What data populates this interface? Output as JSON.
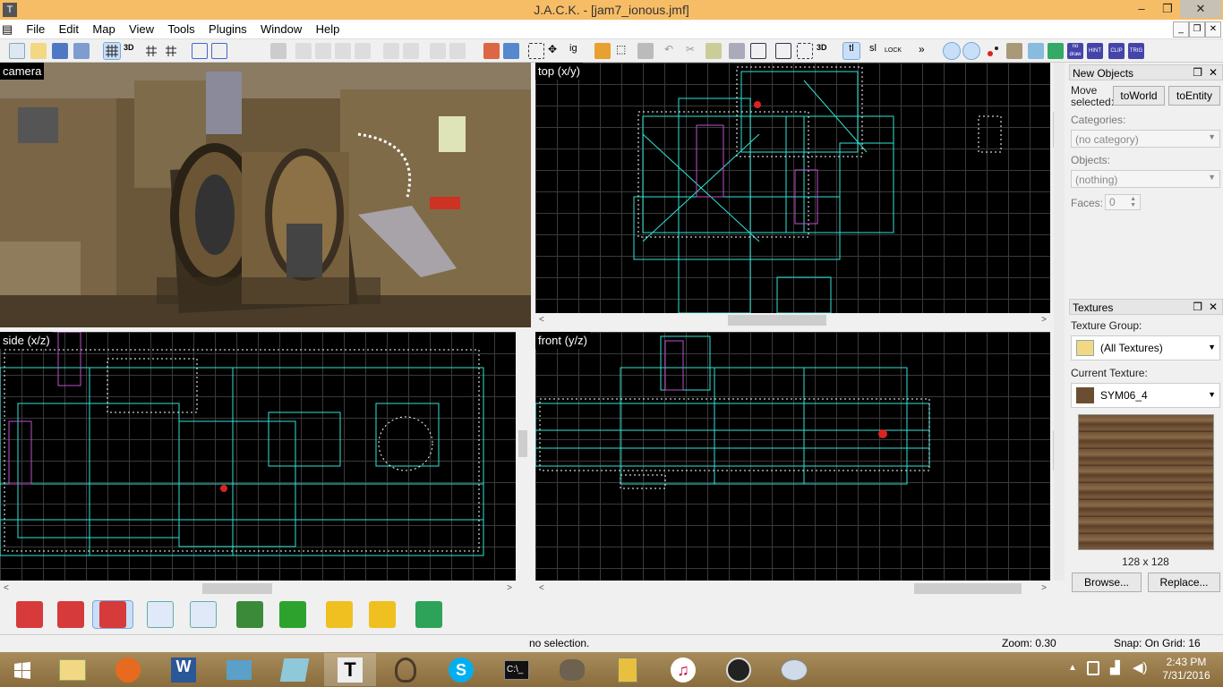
{
  "window": {
    "title": "J.A.C.K. - [jam7_ionous.jmf]",
    "minimize": "–",
    "maximize": "❐",
    "close": "✕"
  },
  "menu": {
    "items": [
      "File",
      "Edit",
      "Map",
      "View",
      "Tools",
      "Plugins",
      "Window",
      "Help"
    ]
  },
  "viewports": {
    "camera": {
      "label": "camera"
    },
    "top": {
      "label": "top (x/y)"
    },
    "side": {
      "label": "side (x/z)"
    },
    "front": {
      "label": "front (y/z)"
    }
  },
  "new_objects": {
    "header": "New Objects",
    "move_selected_label": "Move\nselected:",
    "to_world": "toWorld",
    "to_entity": "toEntity",
    "categories_label": "Categories:",
    "categories_value": "(no category)",
    "objects_label": "Objects:",
    "objects_value": "(nothing)",
    "faces_label": "Faces:",
    "faces_value": "0"
  },
  "textures": {
    "header": "Textures",
    "group_label": "Texture Group:",
    "group_value": "(All Textures)",
    "current_label": "Current Texture:",
    "current_value": "SYM06_4",
    "size": "128 x 128",
    "browse": "Browse...",
    "replace": "Replace..."
  },
  "status": {
    "selection": "no selection.",
    "zoom": "Zoom: 0.30",
    "snap": "Snap: On Grid: 16"
  },
  "taskbar": {
    "time": "2:43 PM",
    "date": "7/31/2016"
  },
  "colors": {
    "titlebar": "#f7bd66",
    "viewport_bg": "#000000",
    "wire_cyan": "#2ee6d6",
    "wire_white": "#ffffff",
    "wire_magenta": "#c04fd0",
    "taskbar": "#9c7e4c"
  }
}
